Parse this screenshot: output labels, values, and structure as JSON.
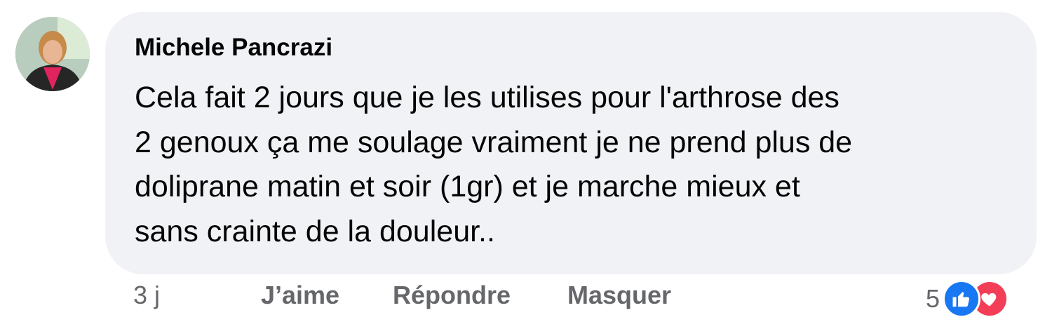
{
  "comment": {
    "author": "Michele Pancrazi",
    "text_lines": [
      "Cela fait 2 jours que je les utilises pour l'arthrose des",
      "2 genoux ça me soulage vraiment je ne prend plus de",
      "doliprane matin et soir (1gr) et je marche mieux et",
      "sans crainte de la douleur.."
    ],
    "timestamp": "3 j",
    "actions": {
      "like_label": "J’aime",
      "reply_label": "Répondre",
      "hide_label": "Masquer"
    },
    "reactions": {
      "count": "5",
      "icons": [
        "like-icon",
        "love-icon"
      ],
      "colors": {
        "like": "#1877f2",
        "love": "#f33e58"
      }
    }
  },
  "colors": {
    "bubble_background": "#f0f2f5",
    "text": "#050505",
    "secondary_text": "#65676b"
  }
}
